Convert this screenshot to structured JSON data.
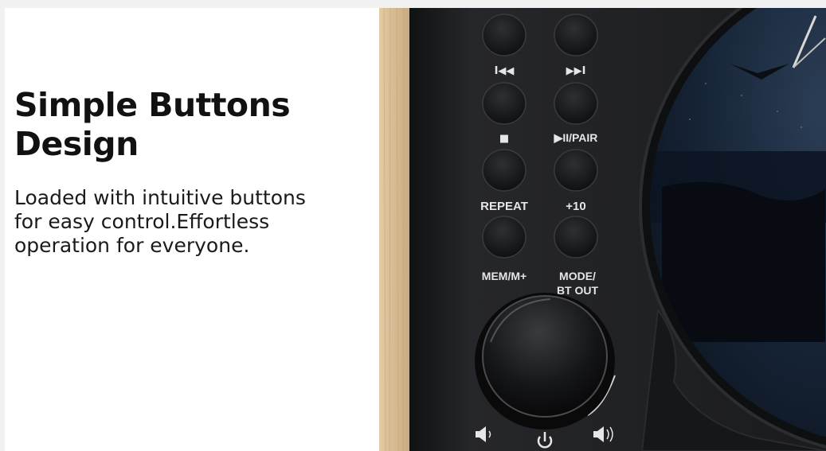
{
  "headline": {
    "line1": "Simple Buttons",
    "line2": "Design"
  },
  "description": {
    "line1": "Loaded with intuitive buttons",
    "line2": "for easy control.Effortless",
    "line3": "operation for everyone."
  },
  "device_labels": {
    "prev": "I◀◀",
    "next": "▶▶I",
    "stop": "■",
    "play_pair": "▶II/PAIR",
    "repeat": "REPEAT",
    "plus10": "+10",
    "mem": "MEM/M+",
    "mode_line1": "MODE/",
    "mode_line2": "BT OUT"
  },
  "colors": {
    "panel": "#1c1d1f",
    "wood": "#d9bf98",
    "label": "#e6e6e6"
  },
  "icons": [
    "volume-down-icon",
    "volume-up-icon",
    "power-icon"
  ]
}
